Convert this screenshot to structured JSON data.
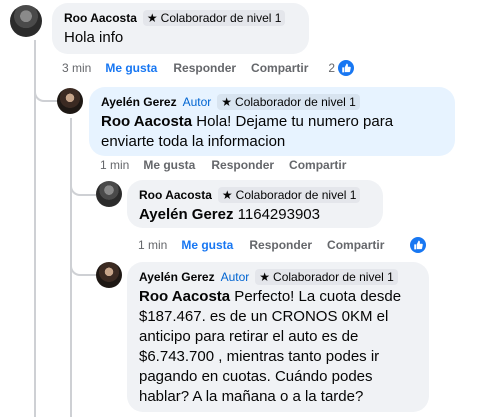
{
  "comments": [
    {
      "author": "Roo Aacosta",
      "badge": "Colaborador de nivel 1",
      "text": "Hola info",
      "time": "3 min",
      "like": "Me gusta",
      "reply": "Responder",
      "share": "Compartir",
      "like_count": "2"
    },
    {
      "author": "Ayelén Gerez",
      "role": "Autor",
      "badge": "Colaborador de nivel 1",
      "mention": "Roo Aacosta",
      "text": " Hola! Dejame tu numero para enviarte toda la informacion",
      "time": "1 min",
      "like": "Me gusta",
      "reply": "Responder",
      "share": "Compartir"
    },
    {
      "author": "Roo Aacosta",
      "badge": "Colaborador de nivel 1",
      "mention": "Ayelén Gerez",
      "text": " 1164293903",
      "time": "1 min",
      "like": "Me gusta",
      "reply": "Responder",
      "share": "Compartir"
    },
    {
      "author": "Ayelén Gerez",
      "role": "Autor",
      "badge": "Colaborador de nivel 1",
      "mention": "Roo Aacosta",
      "text": " Perfecto! La cuota desde $187.467. es de un CRONOS 0KM el anticipo para retirar el auto es de $6.743.700 , mientras tanto podes ir pagando en cuotas. Cuándo podes hablar? A la mañana o a la tarde?"
    }
  ],
  "icons": {
    "badge": "star-icon",
    "like": "thumbs-up-icon"
  },
  "colors": {
    "accent": "#1877f2",
    "author_bubble": "#e7f3ff",
    "bubble": "#f0f2f5"
  }
}
